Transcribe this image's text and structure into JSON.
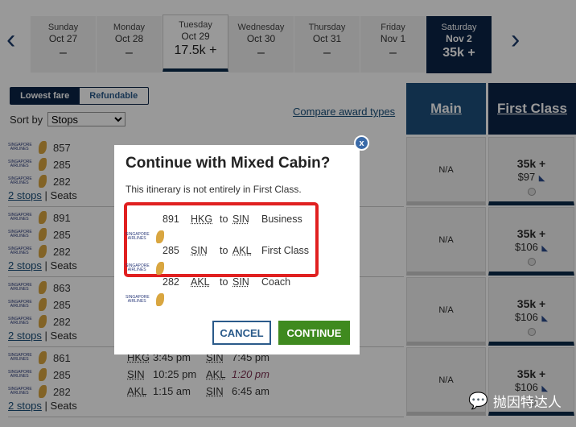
{
  "dates": [
    {
      "day": "Sunday",
      "date": "Oct 27",
      "price": "–"
    },
    {
      "day": "Monday",
      "date": "Oct 28",
      "price": "–"
    },
    {
      "day": "Tuesday",
      "date": "Oct 29",
      "price": "17.5k +"
    },
    {
      "day": "Wednesday",
      "date": "Oct 30",
      "price": "–"
    },
    {
      "day": "Thursday",
      "date": "Oct 31",
      "price": "–"
    },
    {
      "day": "Friday",
      "date": "Nov 1",
      "price": "–"
    },
    {
      "day": "Saturday",
      "date": "Nov 2",
      "price": "35k +"
    }
  ],
  "nav": {
    "prev": "‹",
    "next": "›"
  },
  "filters": {
    "lowest": "Lowest fare",
    "refundable": "Refundable",
    "sort_label": "Sort by",
    "sort_value": "Stops"
  },
  "compare": "Compare award types",
  "columns": {
    "main": "Main",
    "first": "First Class"
  },
  "rows": [
    {
      "flights": [
        "857",
        "285",
        "282"
      ],
      "stops": "2 stops",
      "seats": "Seats",
      "main": "N/A",
      "miles": "35k +",
      "price": "$97"
    },
    {
      "flights": [
        "891",
        "285",
        "282"
      ],
      "stops": "2 stops",
      "seats": "Seats",
      "main": "N/A",
      "miles": "35k +",
      "price": "$106"
    },
    {
      "flights": [
        "863",
        "285",
        "282"
      ],
      "stops": "2 stops",
      "seats": "Seats",
      "main": "N/A",
      "miles": "35k +",
      "price": "$106"
    },
    {
      "flights": [
        "861",
        "285",
        "282"
      ],
      "stops": "2 stops",
      "seats": "Seats",
      "main": "N/A",
      "miles": "35k +",
      "price": "$106"
    }
  ],
  "row4_legs": [
    {
      "from": "HKG",
      "dep": "3:45 pm",
      "to": "SIN",
      "arr": "7:45 pm"
    },
    {
      "from": "SIN",
      "dep": "10:25 pm",
      "to": "AKL",
      "arr": "1:20 pm"
    },
    {
      "from": "AKL",
      "dep": "1:15 am",
      "to": "SIN",
      "arr": "6:45 am"
    }
  ],
  "airline_logo": "SINGAPORE AIRLINES",
  "modal": {
    "title": "Continue with Mixed Cabin?",
    "subtitle": "This itinerary is not entirely in First Class.",
    "segments": [
      {
        "flight": "891",
        "from": "HKG",
        "to_word": "to",
        "to": "SIN",
        "cabin": "Business"
      },
      {
        "flight": "285",
        "from": "SIN",
        "to_word": "to",
        "to": "AKL",
        "cabin": "First Class"
      },
      {
        "flight": "282",
        "from": "AKL",
        "to_word": "to",
        "to": "SIN",
        "cabin": "Coach"
      }
    ],
    "cancel": "CANCEL",
    "continue": "CONTINUE",
    "close": "x"
  },
  "watermark": "抛因特达人",
  "colors": {
    "navy": "#0b2346",
    "main_header": "#1d4f7c",
    "continue": "#3f8a1f",
    "highlight": "#e02020"
  }
}
